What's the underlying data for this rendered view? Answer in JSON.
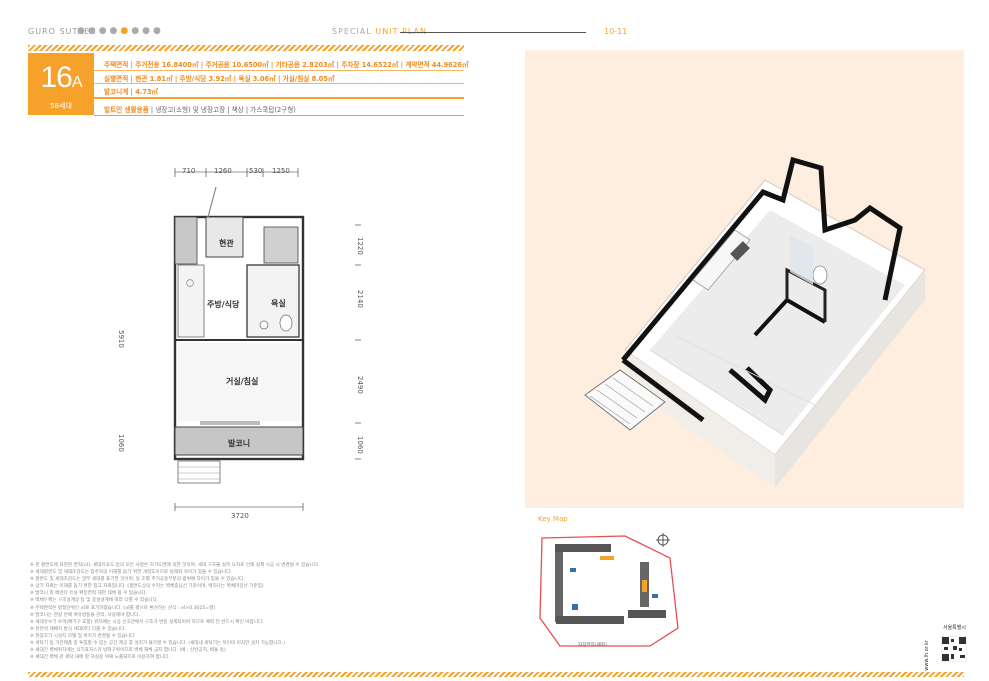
{
  "header": {
    "brand": "GURO SUTAEK",
    "special_prefix": "SPECIAL",
    "special_suffix": "UNIT PLAN",
    "page_numbers": "10-11"
  },
  "unit": {
    "type_main": "16",
    "type_letter": "A",
    "type_sub": "58세대",
    "spec_line1": [
      {
        "k": "주택면적",
        "v": "주거전용"
      },
      {
        "b": "16.8400㎡"
      },
      {
        "k": "주거공용",
        "v": "10.6500㎡"
      },
      {
        "k": "기타공용",
        "v": "2.8203㎡"
      },
      {
        "k": "주차장",
        "v": "14.6522㎡"
      },
      {
        "k": "계약면적",
        "v": "44.9626㎡"
      }
    ],
    "spec1_text": "주택면적 | 주거전용 16.8400㎡ | 주거공용 10.6500㎡ | 기타공용 2.8203㎡ | 주차장 14.6522㎡ | 계약면적 44.9626㎡",
    "spec2_text": "실별면적 | 현관 1.81㎡ | 주방/식당 3.92㎡ | 욕실 3.06㎡ | 거실/침실 8.05㎡",
    "spec3_text": "발코니계 | 4.73㎡",
    "option_label": "빌트인 생활용품",
    "option_text": "냉장고(소형) 및 냉장고장 | 책상 | 가스쿡탑(2구형)"
  },
  "plan": {
    "dim_top": [
      "710",
      "1260",
      "530",
      "1250"
    ],
    "dim_right": [
      "1220",
      "2140",
      "2490",
      "1060"
    ],
    "dim_left": [
      "5910",
      "1060"
    ],
    "dim_bottom": "3720",
    "rooms": {
      "entrance": "현관",
      "kitchen": "주방/식당",
      "bath": "욕실",
      "living": "거실/침실",
      "balcony": "발코니"
    }
  },
  "keymap": {
    "title": "Key Map",
    "road_label": "자작연장(예정)"
  },
  "notes": [
    "※ 본 평면도에 표현된 면적(㎡), 세대유효도 등의 모든 사항은 허가도면에 의한 것이며, 세대 구조물 실측 오차로 인해 실제 시공 시 변경될 수 있습니다.",
    "※ 세대평면도 및 세대조감도는 입주자의 이해를 돕기 위한 개략도이므로 실제와 차이가 있을 수 있습니다.",
    "※ 평면도 및 세대조감도는 일부 세대를 표기한 것이며, 동 호별 주거공용부분의 범위에 차이가 있을 수 있습니다.",
    "※ 상기 자료는 이해를 돕기 위한 참고 자료입니다. (평면도상의 수치는 벽체중심선 기준이며, 벽지나는 벽체마감선 기준임)",
    "※ 발코니 외 베란다 유실 확장면적 대한 대체 될 수 있습니다.",
    "※ 벽체두께는 구조설계상 등 및 증설설계에 따라 다를 수 있습니다.",
    "※ 주택면적은 법정단위인 ㎡로 표기하였습니다. (㎡를 평으로 환산하는 산식 : ㎡×0.3025=평)",
    "※ 발코니는 관람 안에 여유방동을 관리, 사용해야 합니다.",
    "※ 세대유수기 우려(배기구 포함) 위치배는 시공 신호관에서 구조가 변동 설계되어야 하므로 예약 전 반드시 확인 바랍니다.",
    "※ 천연석 재배치 방식 세대마다 다를 수 있습니다.",
    "※ 현장조가 시설지 모델 및 위치가 변경될 수 있습니다.",
    "※ 세탁기 등 가전제품 중 투입할 수 있는 공간 제공 후 설치가 불가할 수 있습니다. (세대내 세탁기는 뒤이미 이처만 설치 가능합니다.)",
    "※ 세대간 벽체위치에는 식기표지스카 방화구획이므로 벽체 해체 금지 합니다. (예 : 신반공지, 벽돌 등)",
    "※ 세대간 벽체 관 세탁 내에 할 차실용 위해 노출되므로 이용하여 합니다."
  ],
  "qr": {
    "logo": "서울특별시",
    "url": "www.lh.or.kr"
  },
  "colors": {
    "accent": "#f6a12a",
    "iso_background": "#fdeee0"
  }
}
